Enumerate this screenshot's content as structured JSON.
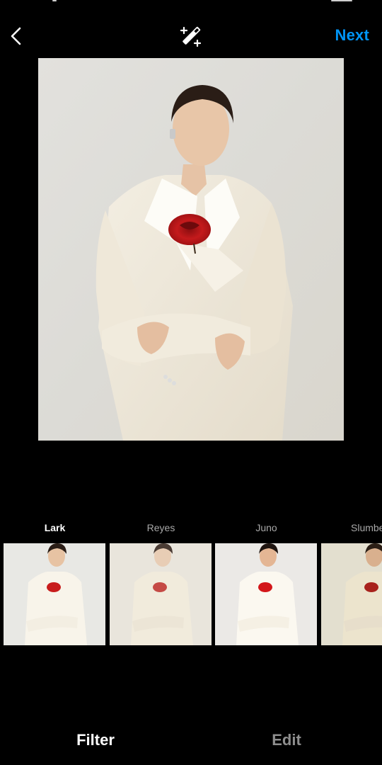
{
  "header": {
    "back_icon": "chevron-left-icon",
    "magic_icon": "magic-wand-sparkle-icon",
    "next_label": "Next",
    "accent_color": "#0095F6"
  },
  "photo": {
    "description": "Woman in cream double-breasted blazer with a red rose at the lapel, arms crossed, light grey backdrop"
  },
  "filters": {
    "selected": "Lark",
    "items": [
      {
        "label": "Lark",
        "selected": true
      },
      {
        "label": "Reyes",
        "selected": false
      },
      {
        "label": "Juno",
        "selected": false
      },
      {
        "label": "Slumber",
        "selected": false
      }
    ]
  },
  "tabs": {
    "active": "Filter",
    "items": [
      {
        "label": "Filter",
        "active": true
      },
      {
        "label": "Edit",
        "active": false
      }
    ]
  }
}
